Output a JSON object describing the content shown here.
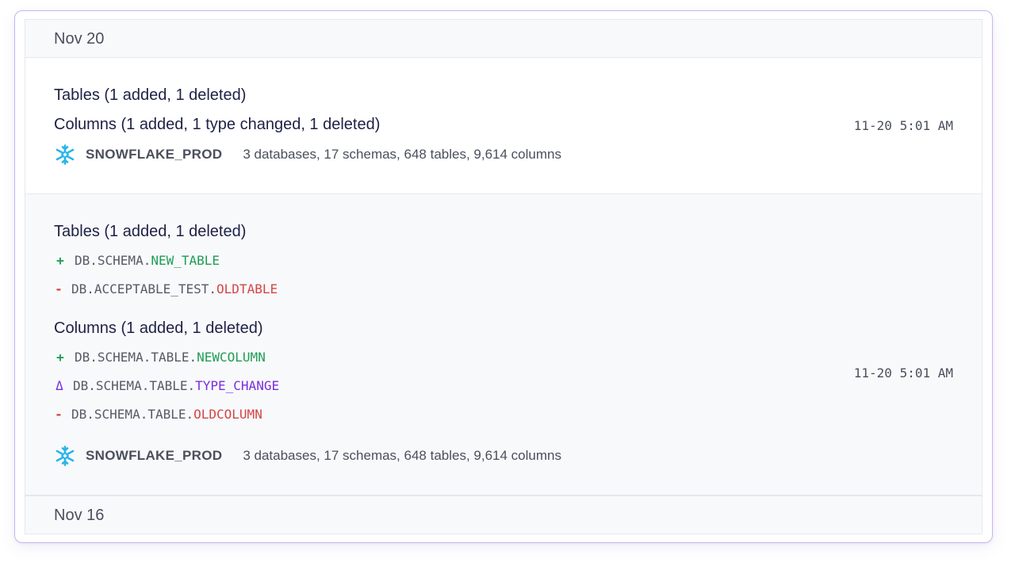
{
  "groups": [
    {
      "date": "Nov 20"
    },
    {
      "date": "Nov 16"
    }
  ],
  "entry_summary": {
    "tables_heading": "Tables (1 added, 1 deleted)",
    "columns_heading": "Columns (1 added, 1 type changed, 1 deleted)",
    "timestamp": "11-20 5:01 AM",
    "source_name": "SNOWFLAKE_PROD",
    "source_stats": "3 databases, 17 schemas, 648 tables, 9,614 columns"
  },
  "entry_detail": {
    "tables_heading": "Tables (1 added, 1 deleted)",
    "tables": [
      {
        "symbol": "+",
        "kind": "add",
        "path": "DB.SCHEMA.",
        "name": "NEW_TABLE"
      },
      {
        "symbol": "-",
        "kind": "del",
        "path": "DB.ACCEPTABLE_TEST.",
        "name": "OLDTABLE"
      }
    ],
    "columns_heading": "Columns (1 added, 1 deleted)",
    "columns": [
      {
        "symbol": "+",
        "kind": "add",
        "path": "DB.SCHEMA.TABLE.",
        "name": "NEWCOLUMN"
      },
      {
        "symbol": "Δ",
        "kind": "chg",
        "path": "DB.SCHEMA.TABLE.",
        "name": "TYPE_CHANGE"
      },
      {
        "symbol": "-",
        "kind": "del",
        "path": "DB.SCHEMA.TABLE.",
        "name": "OLDCOLUMN"
      }
    ],
    "timestamp": "11-20 5:01 AM",
    "source_name": "SNOWFLAKE_PROD",
    "source_stats": "3 databases, 17 schemas, 648 tables, 9,614 columns",
    "source_icon": "snowflake-icon"
  },
  "colors": {
    "added": "#1f9d55",
    "deleted": "#d64545",
    "changed": "#7a2ee0",
    "snowflake": "#29b5e8",
    "frame_border": "#c8b6f2"
  }
}
